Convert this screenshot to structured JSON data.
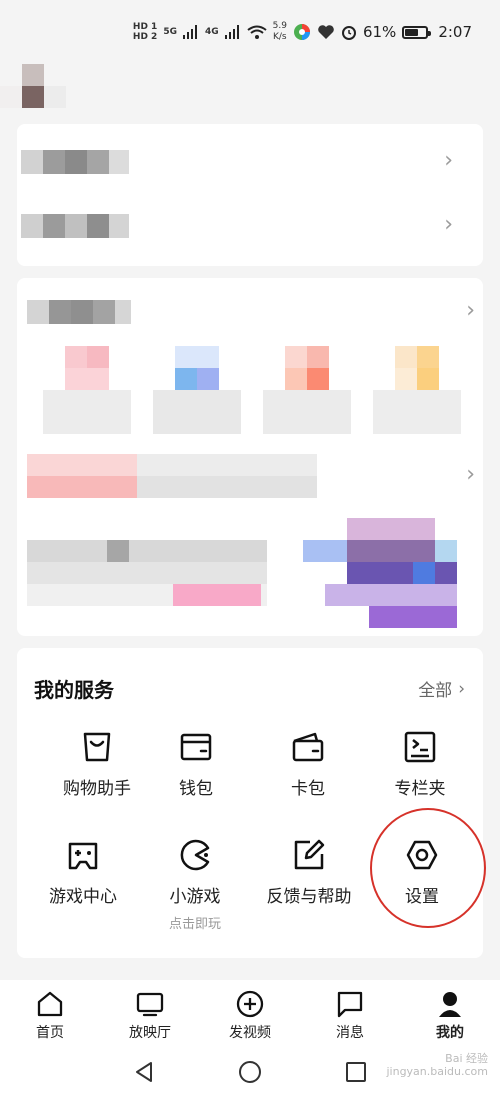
{
  "status_bar": {
    "hd1": "HD 1",
    "hd2": "HD 2",
    "net1": "5G",
    "net2": "4G",
    "speed_value": "5.9",
    "speed_unit": "K/s",
    "battery_percent": "61%",
    "battery_level": 0.61,
    "time": "2:07"
  },
  "services": {
    "title": "我的服务",
    "all_label": "全部",
    "items": [
      {
        "label": "购物助手",
        "icon": "shopping-bag-icon"
      },
      {
        "label": "钱包",
        "icon": "wallet-icon"
      },
      {
        "label": "卡包",
        "icon": "card-wallet-icon"
      },
      {
        "label": "专栏夹",
        "icon": "column-folder-icon"
      },
      {
        "label": "游戏中心",
        "icon": "gamepad-icon"
      },
      {
        "label": "小游戏",
        "sub": "点击即玩",
        "icon": "pacman-icon"
      },
      {
        "label": "反馈与帮助",
        "icon": "edit-feedback-icon"
      },
      {
        "label": "设置",
        "icon": "settings-hexagon-icon"
      }
    ]
  },
  "bottom_nav": {
    "items": [
      {
        "label": "首页",
        "icon": "home-icon"
      },
      {
        "label": "放映厅",
        "icon": "tv-icon"
      },
      {
        "label": "发视频",
        "icon": "add-circle-icon"
      },
      {
        "label": "消息",
        "icon": "message-icon"
      },
      {
        "label": "我的",
        "icon": "profile-icon"
      }
    ]
  },
  "watermark": {
    "line1": "Bai 经验",
    "line2": "jingyan.baidu.com"
  }
}
